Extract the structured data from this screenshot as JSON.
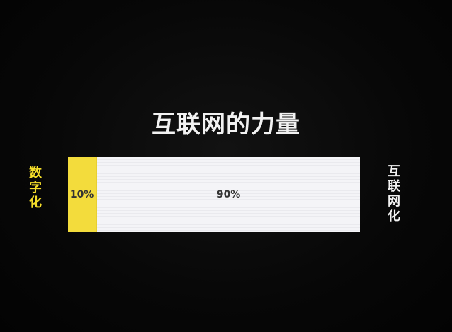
{
  "title": "互联网的力量",
  "left_label": "数字化",
  "right_label": "互联网化",
  "segments": [
    {
      "label": "10%",
      "value": 10,
      "color": "#f3dc3c"
    },
    {
      "label": "90%",
      "value": 90,
      "color": "#f3f3f6"
    }
  ]
}
